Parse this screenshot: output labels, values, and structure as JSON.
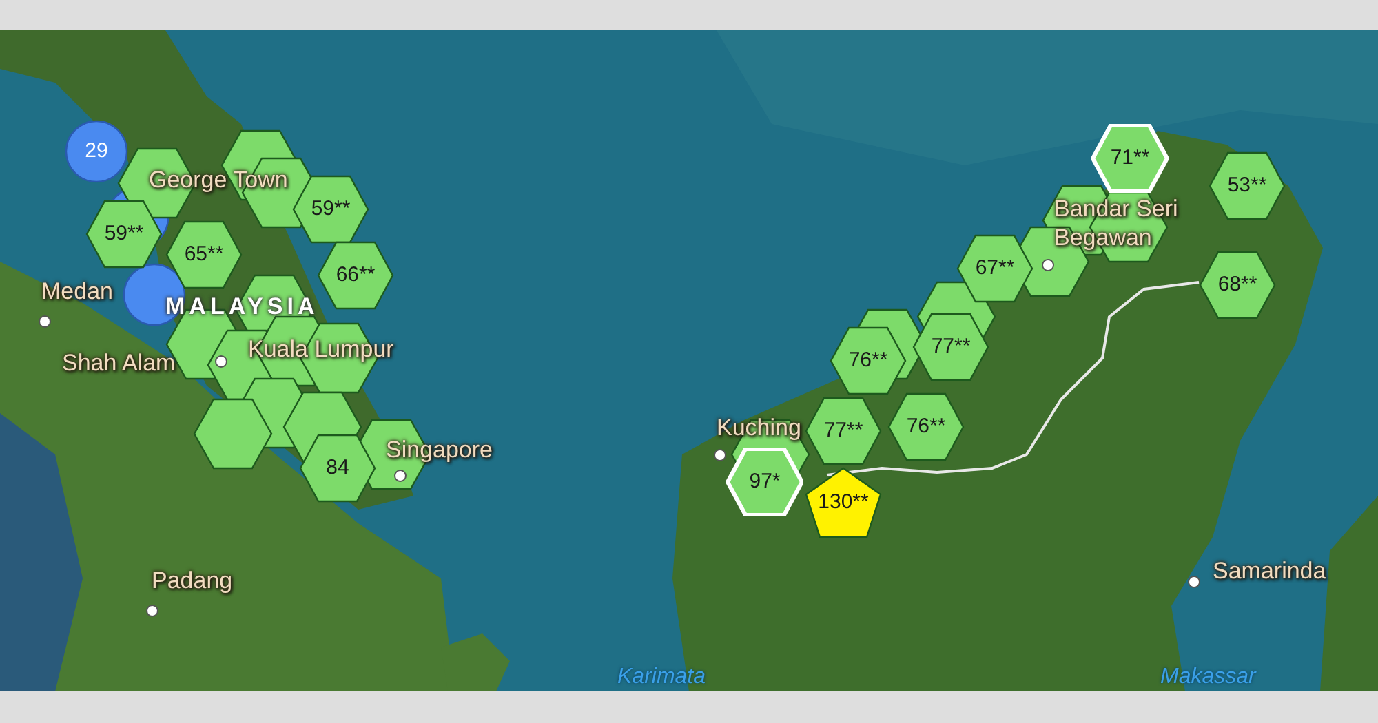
{
  "map": {
    "markers": [
      {
        "kind": "circle",
        "color": "#4a8af0",
        "selected": false,
        "label": "29"
      },
      {
        "kind": "hexagon",
        "color": "#7ddb6a",
        "selected": false,
        "label": "59**"
      },
      {
        "kind": "hexagon",
        "color": "#7ddb6a",
        "selected": false,
        "label": "65**"
      },
      {
        "kind": "hexagon",
        "color": "#7ddb6a",
        "selected": false,
        "label": "59**"
      },
      {
        "kind": "hexagon",
        "color": "#7ddb6a",
        "selected": false,
        "label": "66**"
      },
      {
        "kind": "hexagon",
        "color": "#7ddb6a",
        "selected": false,
        "label": "84"
      },
      {
        "kind": "hexagon",
        "color": "#7ddb6a",
        "selected": true,
        "label": "71**"
      },
      {
        "kind": "hexagon",
        "color": "#7ddb6a",
        "selected": false,
        "label": "53**"
      },
      {
        "kind": "hexagon",
        "color": "#7ddb6a",
        "selected": false,
        "label": "68**"
      },
      {
        "kind": "hexagon",
        "color": "#7ddb6a",
        "selected": false,
        "label": "67**"
      },
      {
        "kind": "hexagon",
        "color": "#7ddb6a",
        "selected": false,
        "label": "77**"
      },
      {
        "kind": "hexagon",
        "color": "#7ddb6a",
        "selected": false,
        "label": "76**"
      },
      {
        "kind": "hexagon",
        "color": "#7ddb6a",
        "selected": false,
        "label": "77**"
      },
      {
        "kind": "hexagon",
        "color": "#7ddb6a",
        "selected": false,
        "label": "76**"
      },
      {
        "kind": "hexagon",
        "color": "#7ddb6a",
        "selected": true,
        "label": "97*"
      },
      {
        "kind": "pentagon",
        "color": "#fff200",
        "selected": false,
        "label": "130**"
      }
    ],
    "places": [
      {
        "kind": "city",
        "label": "George Town"
      },
      {
        "kind": "country",
        "label": "MALAYSIA"
      },
      {
        "kind": "city",
        "label": "Medan"
      },
      {
        "kind": "city",
        "label": "Shah Alam"
      },
      {
        "kind": "city",
        "label": "Kuala Lumpur"
      },
      {
        "kind": "city",
        "label": "Singapore"
      },
      {
        "kind": "city",
        "label": "Padang"
      },
      {
        "kind": "city",
        "label": "Bandar Seri"
      },
      {
        "kind": "city",
        "label": "Begawan"
      },
      {
        "kind": "city",
        "label": "Kuching"
      },
      {
        "kind": "city",
        "label": "Samarinda"
      },
      {
        "kind": "water",
        "label": "Karimata"
      },
      {
        "kind": "water",
        "label": "Makassar"
      }
    ]
  }
}
